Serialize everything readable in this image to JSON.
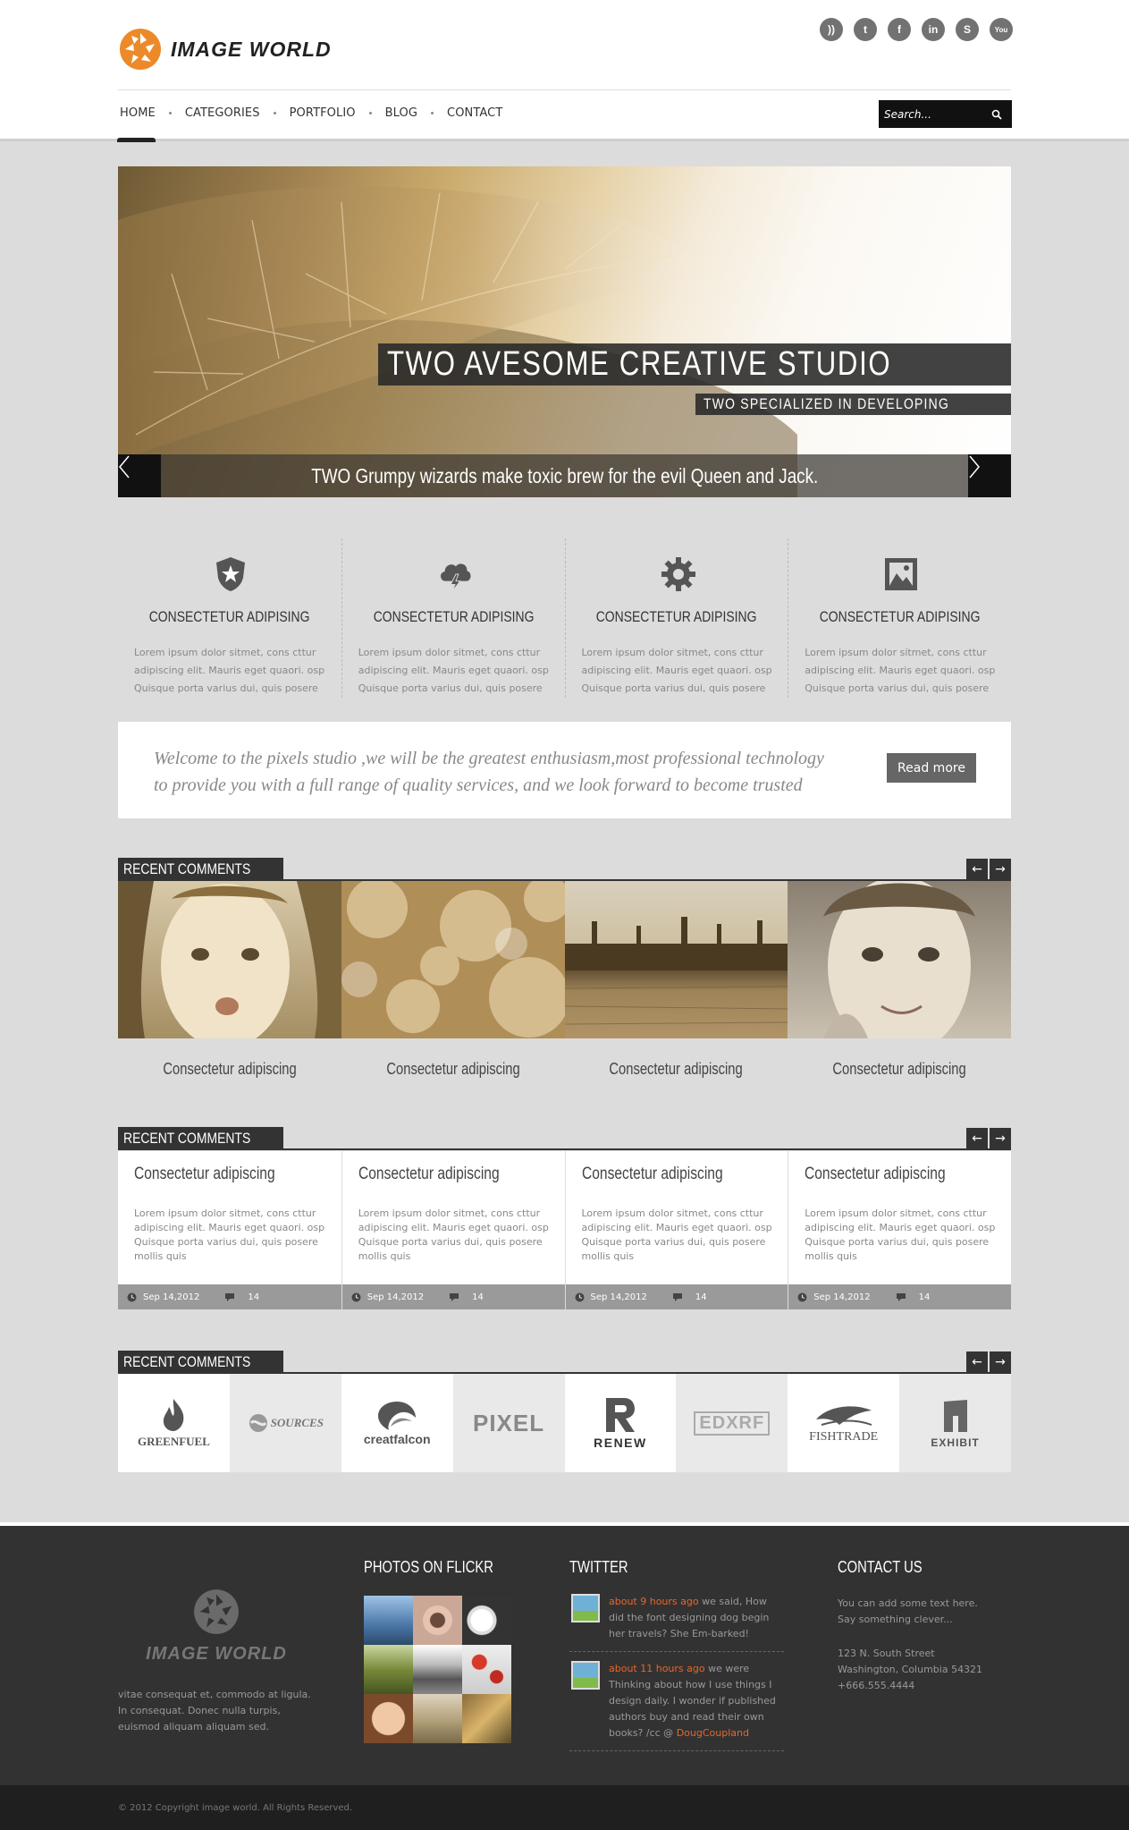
{
  "header": {
    "logo_text": "IMAGE  WORLD",
    "social_icons": [
      "rss-icon",
      "twitter-icon",
      "facebook-icon",
      "linkedin-icon",
      "skype-icon",
      "youtube-icon"
    ],
    "nav": [
      {
        "label": "HOME",
        "active": true
      },
      {
        "label": "CATEGORIES"
      },
      {
        "label": "PORTFOLIO"
      },
      {
        "label": "BLOG"
      },
      {
        "label": "CONTACT"
      }
    ],
    "search_placeholder": "Search..."
  },
  "slider": {
    "title": "TWO AVESOME CREATIVE STUDIO",
    "subtitle": "TWO SPECIALIZED IN DEVELOPING",
    "caption": "TWO Grumpy wizards make toxic brew for the evil Queen and Jack."
  },
  "features": [
    {
      "icon": "badge-icon",
      "title": "CONSECTETUR ADIPISING",
      "text": "Lorem ipsum dolor sitmet, cons cttur adipiscing elit. Mauris eget quaori. osp Quisque porta varius dui, quis posere"
    },
    {
      "icon": "cloud-lightning-icon",
      "title": "CONSECTETUR ADIPISING",
      "text": "Lorem ipsum dolor sitmet, cons cttur adipiscing elit. Mauris eget quaori. osp Quisque porta varius dui, quis posere"
    },
    {
      "icon": "gear-icon",
      "title": "CONSECTETUR ADIPISING",
      "text": "Lorem ipsum dolor sitmet, cons cttur adipiscing elit. Mauris eget quaori. osp Quisque porta varius dui, quis posere"
    },
    {
      "icon": "picture-icon",
      "title": "CONSECTETUR ADIPISING",
      "text": "Lorem ipsum dolor sitmet, cons cttur adipiscing elit. Mauris eget quaori. osp Quisque porta varius dui, quis posere"
    }
  ],
  "welcome": {
    "text": "Welcome to the pixels studio ,we will be the greatest enthusiasm,most professional technology to provide you with a full range of quality services, and we look forward to become trusted",
    "button": "Read more"
  },
  "section_photos": {
    "heading": "RECENT COMMENTS",
    "prev": "←",
    "next": "→",
    "items": [
      {
        "caption": "Consectetur adipiscing"
      },
      {
        "caption": "Consectetur adipiscing"
      },
      {
        "caption": "Consectetur adipiscing"
      },
      {
        "caption": "Consectetur adipiscing"
      }
    ]
  },
  "section_posts": {
    "heading": "RECENT COMMENTS",
    "prev": "←",
    "next": "→",
    "items": [
      {
        "title": "Consectetur adipiscing",
        "text": "Lorem ipsum dolor sitmet, cons cttur adipiscing elit. Mauris eget quaori. osp Quisque porta varius dui, quis posere mollis quis",
        "date": "Sep 14,2012",
        "comments": "14"
      },
      {
        "title": "Consectetur adipiscing",
        "text": "Lorem ipsum dolor sitmet, cons cttur adipiscing elit. Mauris eget quaori. osp Quisque porta varius dui, quis posere mollis quis",
        "date": "Sep 14,2012",
        "comments": "14"
      },
      {
        "title": "Consectetur adipiscing",
        "text": "Lorem ipsum dolor sitmet, cons cttur adipiscing elit. Mauris eget quaori. osp Quisque porta varius dui, quis posere mollis quis",
        "date": "Sep 14,2012",
        "comments": "14"
      },
      {
        "title": "Consectetur adipiscing",
        "text": "Lorem ipsum dolor sitmet, cons cttur adipiscing elit. Mauris eget quaori. osp Quisque porta varius dui, quis posere mollis quis",
        "date": "Sep 14,2012",
        "comments": "14"
      }
    ]
  },
  "section_logos": {
    "heading": "RECENT COMMENTS",
    "prev": "←",
    "next": "→",
    "items": [
      "GREENFUEL",
      "SOURCES",
      "creatfalcon",
      "PIXEL",
      "RENEW",
      "EDXRF",
      "FISHTRADE",
      "EXHIBIT"
    ]
  },
  "footer": {
    "logo_text": "IMAGE  WORLD",
    "about": "vitae consequat et, commodo at ligula. In consequat. Donec nulla turpis, euismod aliquam aliquam sed.",
    "flickr_heading": "PHOTOS ON FLICKR",
    "twitter_heading": "TWITTER",
    "tweets": [
      {
        "time": "about 9 hours ago",
        "text": " we said, How did the font designing dog begin her travels? She Em-barked!",
        "link": ""
      },
      {
        "time": "about 11 hours ago",
        "text": " we were Thinking about how I use things I design daily. I wonder if published authors buy and read their own books? /cc @ ",
        "link": "DougCoupland"
      }
    ],
    "contact_heading": "CONTACT US",
    "contact_intro": "You can add some text here. Say something clever...",
    "address1": "123 N. South Street",
    "address2": "Washington, Columbia 54321",
    "phone": "+666.555.4444",
    "copyright": "© 2012 Copyright image world. All Rights Reserved."
  }
}
